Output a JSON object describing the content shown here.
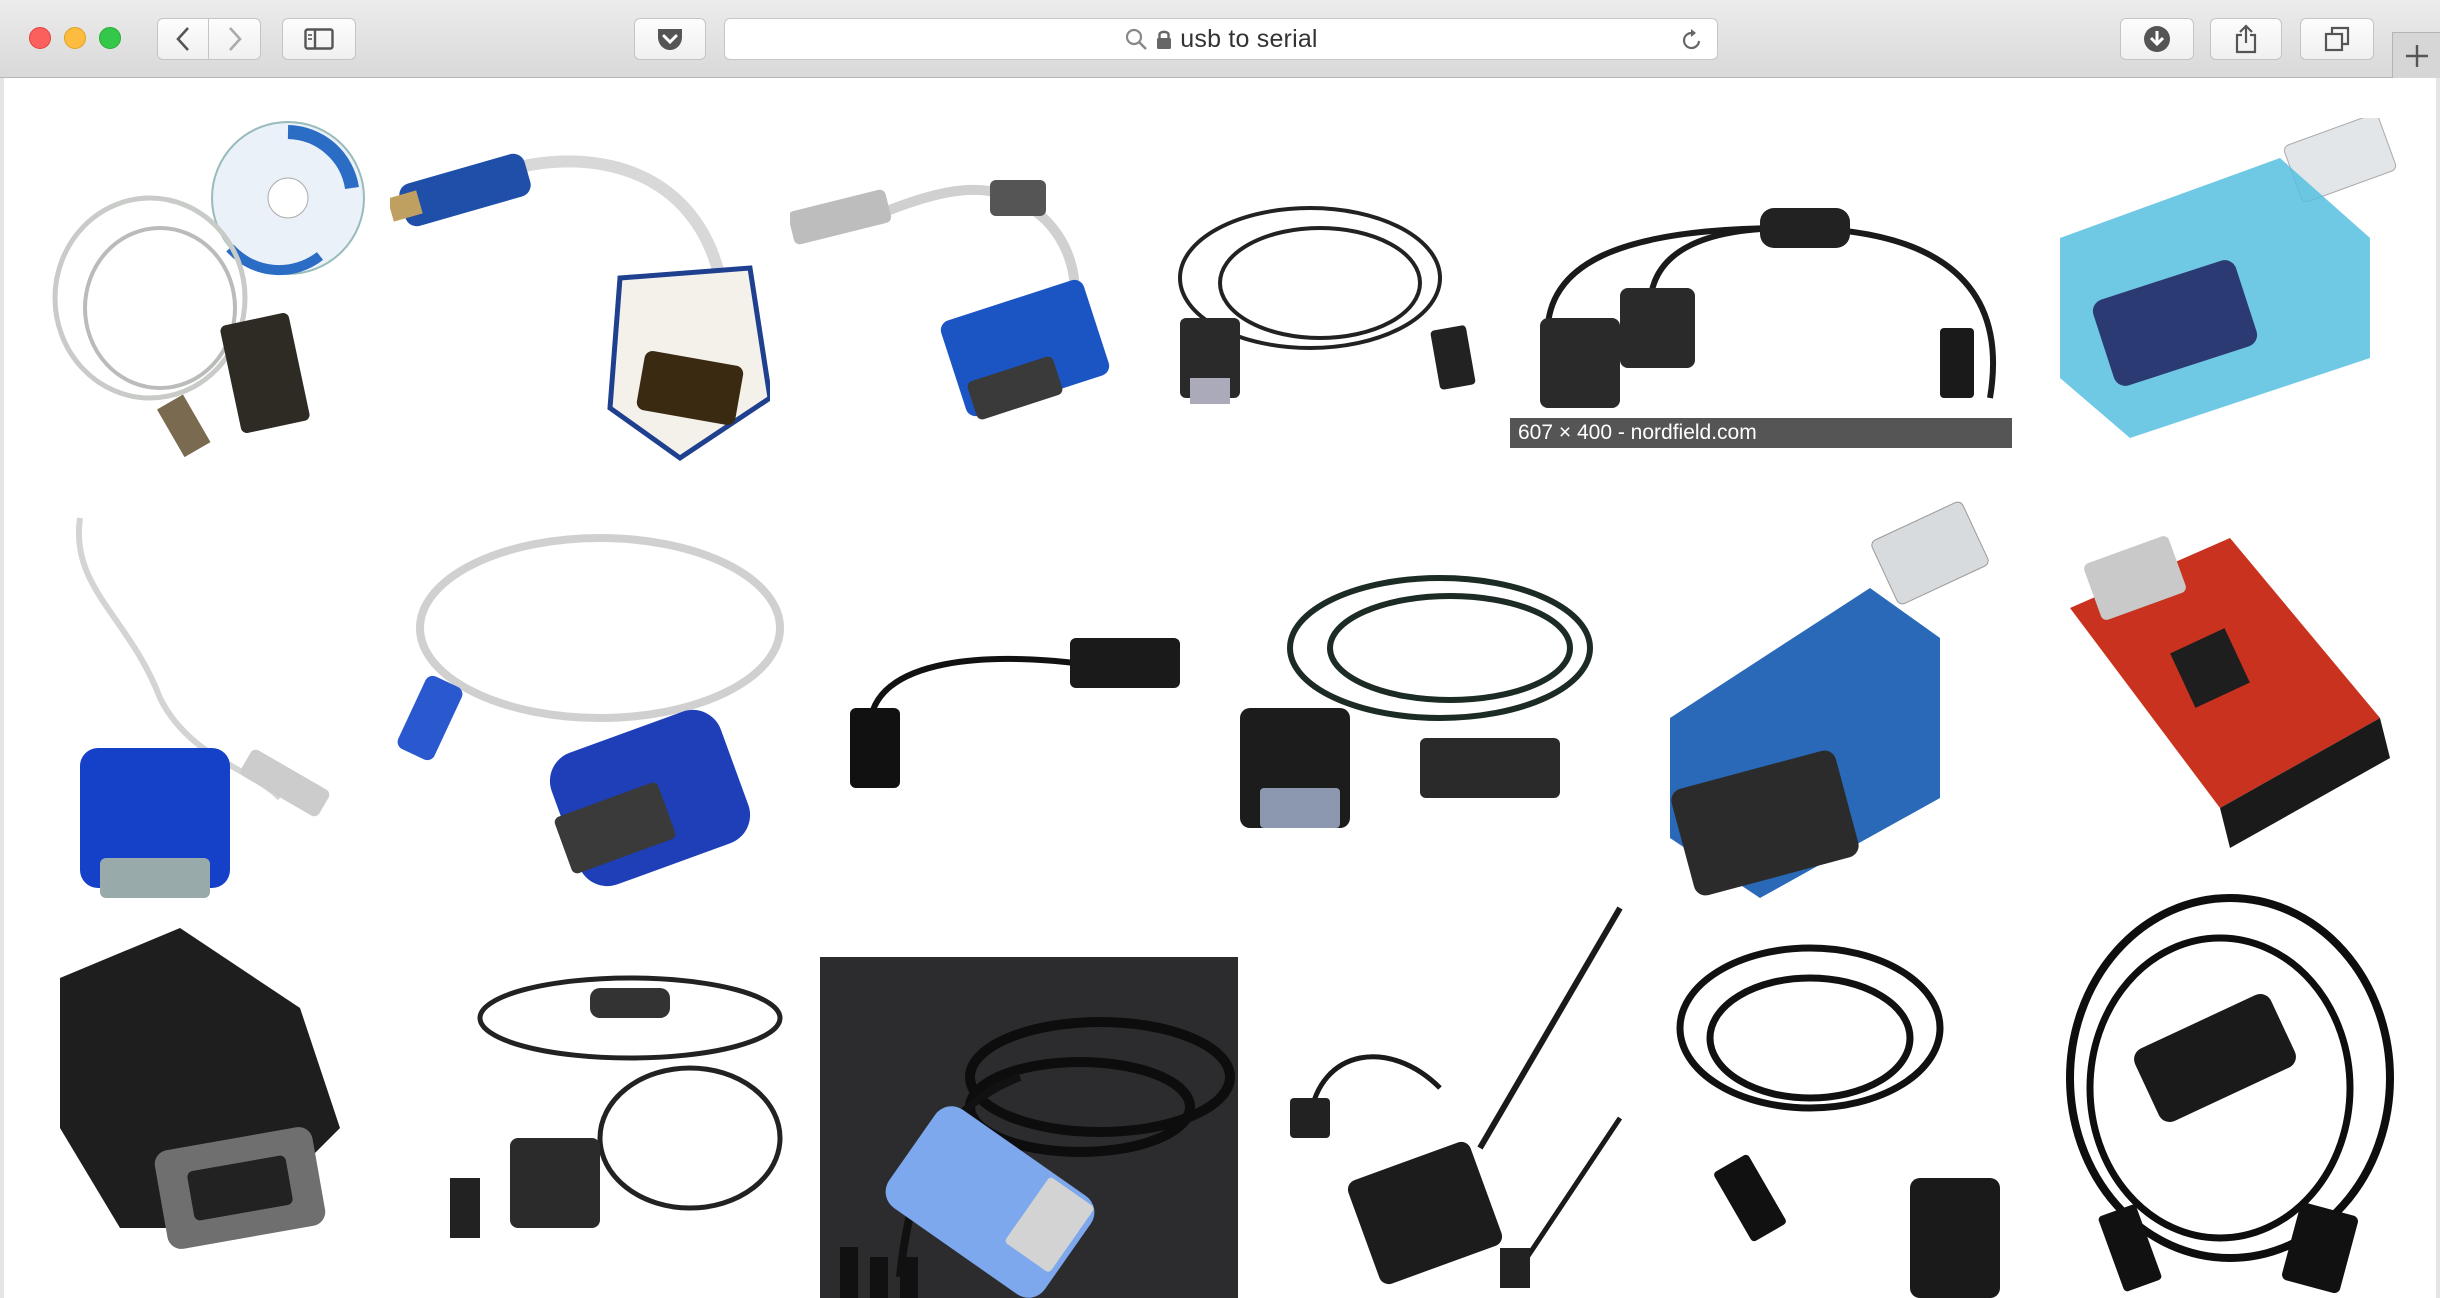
{
  "browser": {
    "address_text": "usb to serial",
    "secure": true
  },
  "toolbar_icons": [
    "close-button",
    "minimize-button",
    "zoom-button",
    "back-icon",
    "forward-icon",
    "sidebar-icon",
    "pocket-icon",
    "search-icon",
    "lock-icon",
    "reload-icon",
    "download-icon",
    "share-icon",
    "tabs-icon",
    "new-tab-icon"
  ],
  "results": {
    "tooltip": "607 × 400 - nordfield.com",
    "images": [
      {
        "subject": "usb-serial-cable-with-driver-cd"
      },
      {
        "subject": "usb-serial-adapter-white-blue"
      },
      {
        "subject": "usb-serial-adapter-blue-ferrite"
      },
      {
        "subject": "usb-serial-cable-black"
      },
      {
        "subject": "usb-dual-serial-cable"
      },
      {
        "subject": "usb-serial-adapter-translucent-cyan"
      },
      {
        "subject": "usb-serial-adapter-blue-cable"
      },
      {
        "subject": "usb-serial-adapter-siig"
      },
      {
        "subject": "usb-serial-cable-short"
      },
      {
        "subject": "usb-serial-cable-coiled"
      },
      {
        "subject": "usb-serial-adapter-blue-dongle"
      },
      {
        "subject": "ftdi-breakout-board-red"
      },
      {
        "subject": "usb-serial-adapter-black"
      },
      {
        "subject": "usb-dual-serial-cable-coiled"
      },
      {
        "subject": "usb-ttl-serial-cable"
      },
      {
        "subject": "micro-usb-serial-cable"
      },
      {
        "subject": "usb-serial-cable-black-coiled"
      },
      {
        "subject": "usb-b-serial-cable"
      }
    ]
  },
  "colors": {
    "toolbar_top": "#ececec",
    "toolbar_bottom": "#d9d9d9",
    "traffic_red": "#fc605c",
    "traffic_yellow": "#fdbc40",
    "traffic_green": "#34c84a",
    "tooltip_bg": "#555555"
  }
}
